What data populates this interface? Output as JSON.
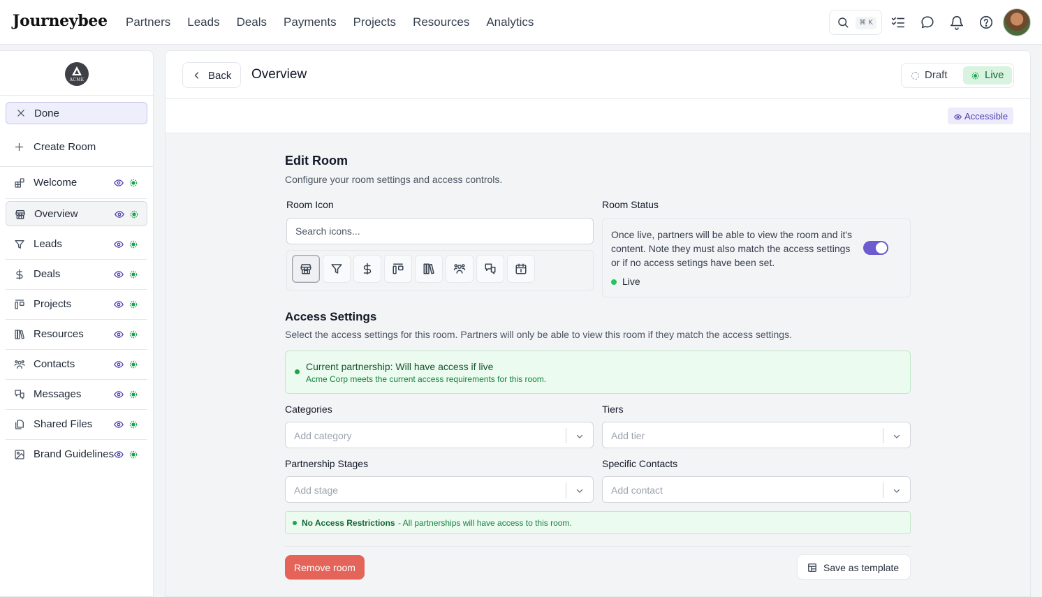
{
  "brand": {
    "logo": "Journeybee"
  },
  "nav": {
    "links": [
      "Partners",
      "Leads",
      "Deals",
      "Payments",
      "Projects",
      "Resources",
      "Analytics"
    ],
    "search_shortcut": "⌘ K"
  },
  "sidebar": {
    "org_logo": "ACME",
    "done_label": "Done",
    "create_label": "Create Room",
    "items": [
      {
        "label": "Welcome",
        "icon": "blocks-icon"
      },
      {
        "label": "Overview",
        "icon": "store-icon",
        "active": true
      },
      {
        "label": "Leads",
        "icon": "funnel-icon"
      },
      {
        "label": "Deals",
        "icon": "dollar-icon"
      },
      {
        "label": "Projects",
        "icon": "kanban-icon"
      },
      {
        "label": "Resources",
        "icon": "library-icon"
      },
      {
        "label": "Contacts",
        "icon": "users-icon"
      },
      {
        "label": "Messages",
        "icon": "messages-icon"
      },
      {
        "label": "Shared Files",
        "icon": "files-icon"
      },
      {
        "label": "Brand Guidelines",
        "icon": "image-icon"
      }
    ]
  },
  "header": {
    "back_label": "Back",
    "title": "Overview",
    "status_draft": "Draft",
    "status_live": "Live",
    "accessible_badge": "Accessible"
  },
  "form": {
    "title": "Edit Room",
    "subtitle": "Configure your room settings and access controls.",
    "room_icon_label": "Room Icon",
    "icon_search_placeholder": "Search icons...",
    "icon_options": [
      "store-icon",
      "funnel-icon",
      "dollar-icon",
      "kanban-icon",
      "library-icon",
      "users-icon",
      "messages-icon",
      "calendar-icon"
    ],
    "room_status_label": "Room Status",
    "room_status_desc": "Once live, partners will be able to view the room and it's content. Note they must also match the access settings or if no access setings have been set.",
    "room_status_value": "Live",
    "room_status_on": true,
    "access_title": "Access Settings",
    "access_desc": "Select the access settings for this room. Partners will only be able to view this room if they match the access settings.",
    "access_ok_title": "Current partnership: Will have access if live",
    "access_ok_desc": "Acme Corp meets the current access requirements for this room.",
    "categories_label": "Categories",
    "categories_placeholder": "Add category",
    "tiers_label": "Tiers",
    "tiers_placeholder": "Add tier",
    "stages_label": "Partnership Stages",
    "stages_placeholder": "Add stage",
    "contacts_label": "Specific Contacts",
    "contacts_placeholder": "Add contact",
    "no_restrict_bold": "No Access Restrictions",
    "no_restrict_rest": "- All partnerships will have access to this room.",
    "remove_label": "Remove room",
    "template_label": "Save as template"
  },
  "colors": {
    "accent": "#6d5bd0",
    "live": "#22c55e",
    "danger": "#e5645a"
  }
}
